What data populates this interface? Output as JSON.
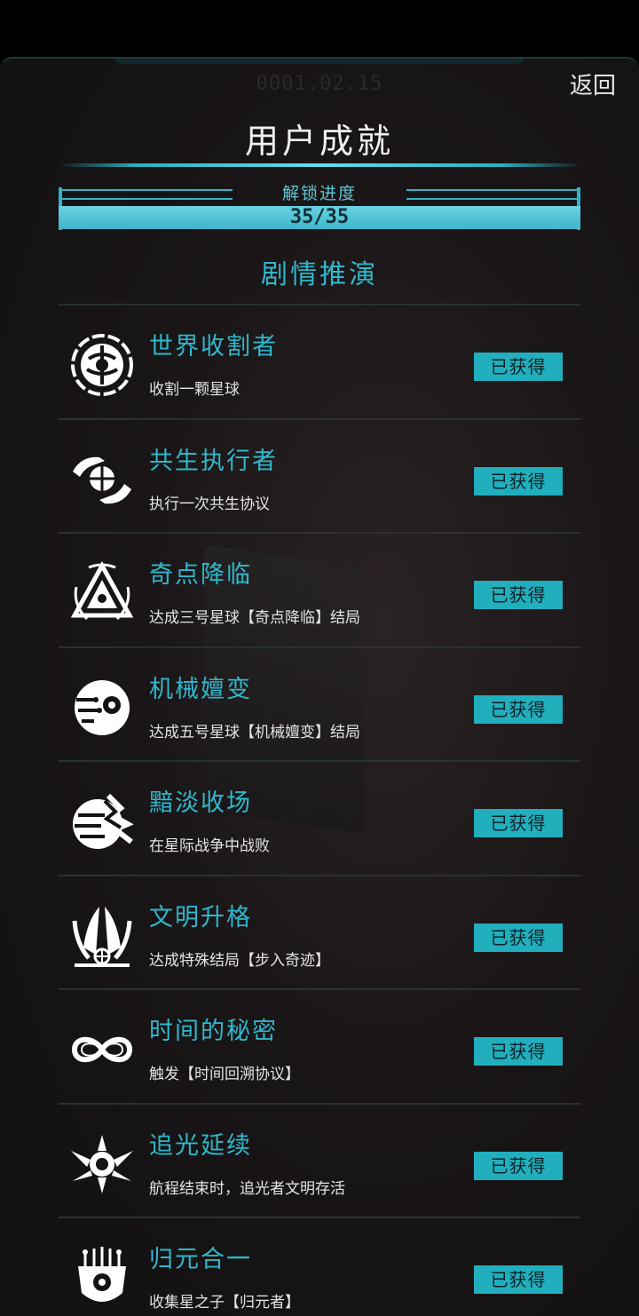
{
  "header": {
    "date": "0001.02.15",
    "back_label": "返回",
    "title": "用户成就"
  },
  "progress": {
    "label": "解锁进度",
    "value_text": "35/35",
    "unlocked": 35,
    "total": 35,
    "fraction": 1.0
  },
  "section": {
    "title": "剧情推演"
  },
  "achievements": [
    {
      "name": "世界收割者",
      "desc": "收割一颗星球",
      "status": "已获得",
      "icon": "planet-harvest-icon"
    },
    {
      "name": "共生执行者",
      "desc": "执行一次共生协议",
      "status": "已获得",
      "icon": "globe-hands-icon"
    },
    {
      "name": "奇点降临",
      "desc": "达成三号星球【奇点降临】结局",
      "status": "已获得",
      "icon": "singularity-triangle-icon"
    },
    {
      "name": "机械嬗变",
      "desc": "达成五号星球【机械嬗变】结局",
      "status": "已获得",
      "icon": "mechanical-eye-icon"
    },
    {
      "name": "黯淡收场",
      "desc": "在星际战争中战败",
      "status": "已获得",
      "icon": "broken-planet-icon"
    },
    {
      "name": "文明升格",
      "desc": "达成特殊结局【步入奇迹】",
      "status": "已获得",
      "icon": "winged-emblem-icon"
    },
    {
      "name": "时间的秘密",
      "desc": "触发【时间回溯协议】",
      "status": "已获得",
      "icon": "infinity-icon"
    },
    {
      "name": "追光延续",
      "desc": "航程结束时，追光者文明存活",
      "status": "已获得",
      "icon": "winged-star-icon"
    },
    {
      "name": "归元合一",
      "desc": "收集星之子【归元者】",
      "status": "已获得",
      "icon": "circuit-mask-icon"
    }
  ],
  "colors": {
    "accent": "#2fb8cc",
    "badge_bg": "#21aebd",
    "background": "#161314"
  }
}
